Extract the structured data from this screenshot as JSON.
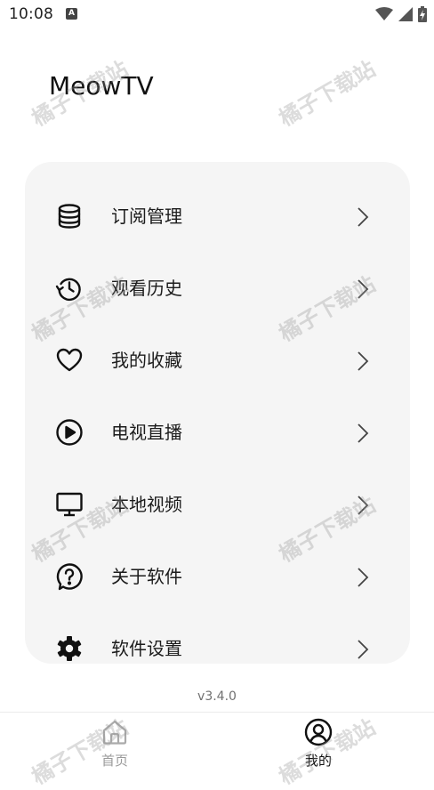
{
  "status_bar": {
    "time": "10:08",
    "notification_glyph": "A",
    "icons": [
      "wifi-icon",
      "signal-icon",
      "battery-charging-icon"
    ]
  },
  "app": {
    "title": "MeowTV"
  },
  "menu": {
    "items": [
      {
        "label": "订阅管理",
        "icon": "database-icon"
      },
      {
        "label": "观看历史",
        "icon": "history-icon"
      },
      {
        "label": "我的收藏",
        "icon": "heart-icon"
      },
      {
        "label": "电视直播",
        "icon": "play-circle-icon"
      },
      {
        "label": "本地视频",
        "icon": "monitor-icon"
      },
      {
        "label": "关于软件",
        "icon": "help-bubble-icon"
      },
      {
        "label": "软件设置",
        "icon": "gear-icon"
      }
    ]
  },
  "version": "v3.4.0",
  "bottom_nav": {
    "items": [
      {
        "label": "首页",
        "icon": "home-icon",
        "selected": false
      },
      {
        "label": "我的",
        "icon": "user-circle-icon",
        "selected": true
      }
    ]
  },
  "watermark": {
    "text": "橘子下载站"
  },
  "colors": {
    "card_background": "#f5f5f5",
    "text_primary": "#1c1c1c",
    "nav_inactive": "#9a9a9a",
    "nav_active": "#111111",
    "version_text": "#707070"
  }
}
